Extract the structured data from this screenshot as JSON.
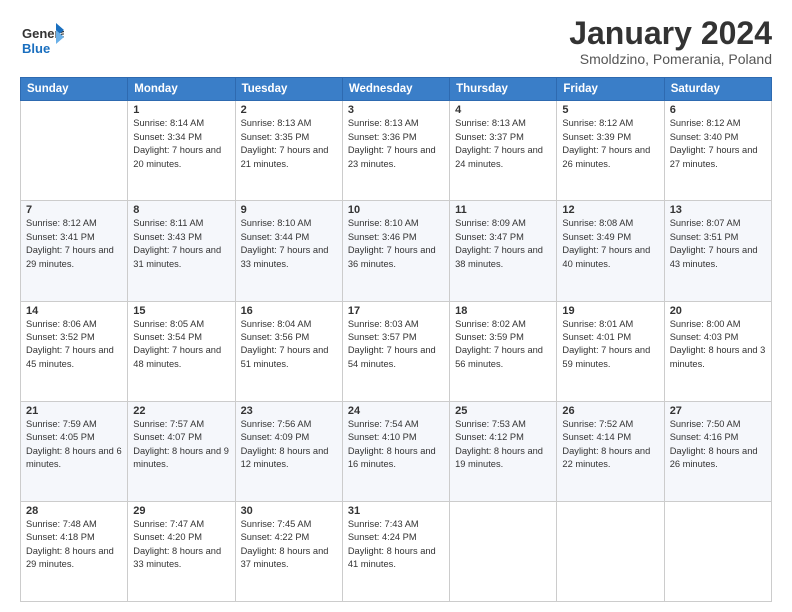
{
  "header": {
    "logo_general": "General",
    "logo_blue": "Blue",
    "month": "January 2024",
    "location": "Smoldzino, Pomerania, Poland"
  },
  "days_of_week": [
    "Sunday",
    "Monday",
    "Tuesday",
    "Wednesday",
    "Thursday",
    "Friday",
    "Saturday"
  ],
  "weeks": [
    [
      {
        "day": "",
        "sunrise": "",
        "sunset": "",
        "daylight": ""
      },
      {
        "day": "1",
        "sunrise": "Sunrise: 8:14 AM",
        "sunset": "Sunset: 3:34 PM",
        "daylight": "Daylight: 7 hours and 20 minutes."
      },
      {
        "day": "2",
        "sunrise": "Sunrise: 8:13 AM",
        "sunset": "Sunset: 3:35 PM",
        "daylight": "Daylight: 7 hours and 21 minutes."
      },
      {
        "day": "3",
        "sunrise": "Sunrise: 8:13 AM",
        "sunset": "Sunset: 3:36 PM",
        "daylight": "Daylight: 7 hours and 23 minutes."
      },
      {
        "day": "4",
        "sunrise": "Sunrise: 8:13 AM",
        "sunset": "Sunset: 3:37 PM",
        "daylight": "Daylight: 7 hours and 24 minutes."
      },
      {
        "day": "5",
        "sunrise": "Sunrise: 8:12 AM",
        "sunset": "Sunset: 3:39 PM",
        "daylight": "Daylight: 7 hours and 26 minutes."
      },
      {
        "day": "6",
        "sunrise": "Sunrise: 8:12 AM",
        "sunset": "Sunset: 3:40 PM",
        "daylight": "Daylight: 7 hours and 27 minutes."
      }
    ],
    [
      {
        "day": "7",
        "sunrise": "Sunrise: 8:12 AM",
        "sunset": "Sunset: 3:41 PM",
        "daylight": "Daylight: 7 hours and 29 minutes."
      },
      {
        "day": "8",
        "sunrise": "Sunrise: 8:11 AM",
        "sunset": "Sunset: 3:43 PM",
        "daylight": "Daylight: 7 hours and 31 minutes."
      },
      {
        "day": "9",
        "sunrise": "Sunrise: 8:10 AM",
        "sunset": "Sunset: 3:44 PM",
        "daylight": "Daylight: 7 hours and 33 minutes."
      },
      {
        "day": "10",
        "sunrise": "Sunrise: 8:10 AM",
        "sunset": "Sunset: 3:46 PM",
        "daylight": "Daylight: 7 hours and 36 minutes."
      },
      {
        "day": "11",
        "sunrise": "Sunrise: 8:09 AM",
        "sunset": "Sunset: 3:47 PM",
        "daylight": "Daylight: 7 hours and 38 minutes."
      },
      {
        "day": "12",
        "sunrise": "Sunrise: 8:08 AM",
        "sunset": "Sunset: 3:49 PM",
        "daylight": "Daylight: 7 hours and 40 minutes."
      },
      {
        "day": "13",
        "sunrise": "Sunrise: 8:07 AM",
        "sunset": "Sunset: 3:51 PM",
        "daylight": "Daylight: 7 hours and 43 minutes."
      }
    ],
    [
      {
        "day": "14",
        "sunrise": "Sunrise: 8:06 AM",
        "sunset": "Sunset: 3:52 PM",
        "daylight": "Daylight: 7 hours and 45 minutes."
      },
      {
        "day": "15",
        "sunrise": "Sunrise: 8:05 AM",
        "sunset": "Sunset: 3:54 PM",
        "daylight": "Daylight: 7 hours and 48 minutes."
      },
      {
        "day": "16",
        "sunrise": "Sunrise: 8:04 AM",
        "sunset": "Sunset: 3:56 PM",
        "daylight": "Daylight: 7 hours and 51 minutes."
      },
      {
        "day": "17",
        "sunrise": "Sunrise: 8:03 AM",
        "sunset": "Sunset: 3:57 PM",
        "daylight": "Daylight: 7 hours and 54 minutes."
      },
      {
        "day": "18",
        "sunrise": "Sunrise: 8:02 AM",
        "sunset": "Sunset: 3:59 PM",
        "daylight": "Daylight: 7 hours and 56 minutes."
      },
      {
        "day": "19",
        "sunrise": "Sunrise: 8:01 AM",
        "sunset": "Sunset: 4:01 PM",
        "daylight": "Daylight: 7 hours and 59 minutes."
      },
      {
        "day": "20",
        "sunrise": "Sunrise: 8:00 AM",
        "sunset": "Sunset: 4:03 PM",
        "daylight": "Daylight: 8 hours and 3 minutes."
      }
    ],
    [
      {
        "day": "21",
        "sunrise": "Sunrise: 7:59 AM",
        "sunset": "Sunset: 4:05 PM",
        "daylight": "Daylight: 8 hours and 6 minutes."
      },
      {
        "day": "22",
        "sunrise": "Sunrise: 7:57 AM",
        "sunset": "Sunset: 4:07 PM",
        "daylight": "Daylight: 8 hours and 9 minutes."
      },
      {
        "day": "23",
        "sunrise": "Sunrise: 7:56 AM",
        "sunset": "Sunset: 4:09 PM",
        "daylight": "Daylight: 8 hours and 12 minutes."
      },
      {
        "day": "24",
        "sunrise": "Sunrise: 7:54 AM",
        "sunset": "Sunset: 4:10 PM",
        "daylight": "Daylight: 8 hours and 16 minutes."
      },
      {
        "day": "25",
        "sunrise": "Sunrise: 7:53 AM",
        "sunset": "Sunset: 4:12 PM",
        "daylight": "Daylight: 8 hours and 19 minutes."
      },
      {
        "day": "26",
        "sunrise": "Sunrise: 7:52 AM",
        "sunset": "Sunset: 4:14 PM",
        "daylight": "Daylight: 8 hours and 22 minutes."
      },
      {
        "day": "27",
        "sunrise": "Sunrise: 7:50 AM",
        "sunset": "Sunset: 4:16 PM",
        "daylight": "Daylight: 8 hours and 26 minutes."
      }
    ],
    [
      {
        "day": "28",
        "sunrise": "Sunrise: 7:48 AM",
        "sunset": "Sunset: 4:18 PM",
        "daylight": "Daylight: 8 hours and 29 minutes."
      },
      {
        "day": "29",
        "sunrise": "Sunrise: 7:47 AM",
        "sunset": "Sunset: 4:20 PM",
        "daylight": "Daylight: 8 hours and 33 minutes."
      },
      {
        "day": "30",
        "sunrise": "Sunrise: 7:45 AM",
        "sunset": "Sunset: 4:22 PM",
        "daylight": "Daylight: 8 hours and 37 minutes."
      },
      {
        "day": "31",
        "sunrise": "Sunrise: 7:43 AM",
        "sunset": "Sunset: 4:24 PM",
        "daylight": "Daylight: 8 hours and 41 minutes."
      },
      {
        "day": "",
        "sunrise": "",
        "sunset": "",
        "daylight": ""
      },
      {
        "day": "",
        "sunrise": "",
        "sunset": "",
        "daylight": ""
      },
      {
        "day": "",
        "sunrise": "",
        "sunset": "",
        "daylight": ""
      }
    ]
  ]
}
